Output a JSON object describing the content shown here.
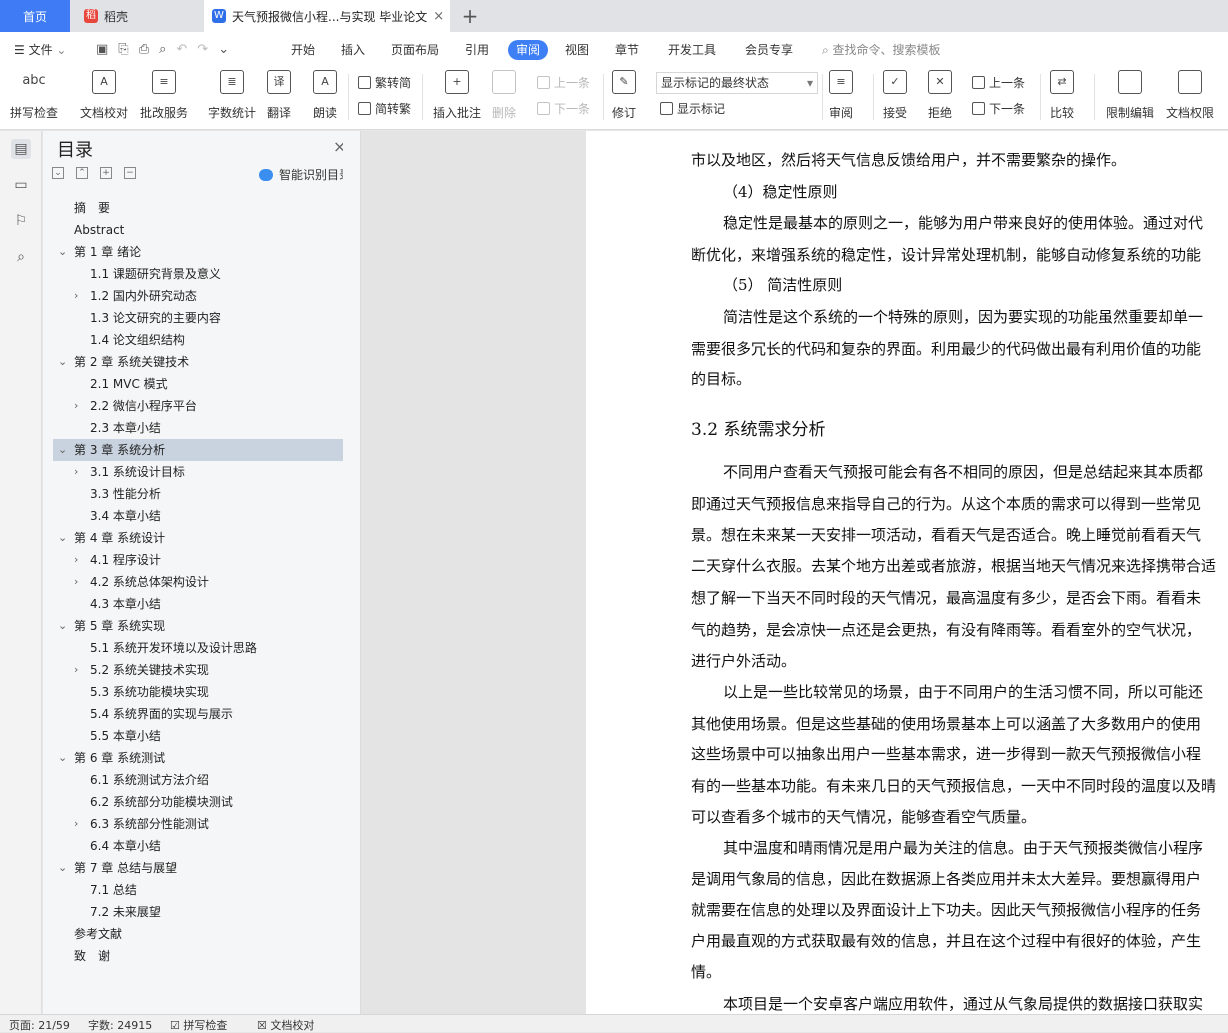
{
  "tabs": {
    "home": "首页",
    "daoke": "稻壳",
    "doc": "天气预报微信小程...与实现 毕业论文",
    "add": "+"
  },
  "menu": {
    "file": "文件",
    "items": [
      "开始",
      "插入",
      "页面布局",
      "引用",
      "审阅",
      "视图",
      "章节",
      "开发工具",
      "会员专享"
    ],
    "search": "查找命令、搜索模板"
  },
  "ribbon": {
    "spell": "拼写检查",
    "doccheck": "文档校对",
    "batch": "批改服务",
    "wordcount": "字数统计",
    "translate": "翻译",
    "read": "朗读",
    "trad": "繁转简",
    "simp": "简转繁",
    "comment": "插入批注",
    "delete": "删除",
    "prev": "上一条",
    "next": "下一条",
    "revise": "修订",
    "markstate": "显示标记的最终状态",
    "showmark": "显示标记",
    "review": "审阅",
    "accept": "接受",
    "reject": "拒绝",
    "prev2": "上一条",
    "next2": "下一条",
    "compare": "比较",
    "restrict": "限制编辑",
    "rights": "文档权限",
    "abc": "abc"
  },
  "nav": {
    "title": "目录",
    "smart": "智能识别目录",
    "items": [
      {
        "t": "摘　要",
        "lvl": 1,
        "arrow": ""
      },
      {
        "t": "Abstract",
        "lvl": 1,
        "arrow": ""
      },
      {
        "t": "第 1 章  绪论",
        "lvl": 1,
        "arrow": "v"
      },
      {
        "t": "1.1 课题研究背景及意义",
        "lvl": 2,
        "arrow": ""
      },
      {
        "t": "1.2 国内外研究动态",
        "lvl": 2,
        "arrow": ">"
      },
      {
        "t": "1.3 论文研究的主要内容",
        "lvl": 2,
        "arrow": ""
      },
      {
        "t": "1.4 论文组织结构",
        "lvl": 2,
        "arrow": ""
      },
      {
        "t": "第 2 章  系统关键技术",
        "lvl": 1,
        "arrow": "v"
      },
      {
        "t": "2.1 MVC 模式",
        "lvl": 2,
        "arrow": ""
      },
      {
        "t": "2.2  微信小程序平台",
        "lvl": 2,
        "arrow": ">"
      },
      {
        "t": "2.3 本章小结",
        "lvl": 2,
        "arrow": ""
      },
      {
        "t": "第 3 章  系统分析",
        "lvl": 1,
        "arrow": "v"
      },
      {
        "t": "3.1 系统设计目标",
        "lvl": 2,
        "arrow": ">"
      },
      {
        "t": "3.3 性能分析",
        "lvl": 2,
        "arrow": ""
      },
      {
        "t": "3.4 本章小结",
        "lvl": 2,
        "arrow": ""
      },
      {
        "t": "第 4 章  系统设计",
        "lvl": 1,
        "arrow": "v"
      },
      {
        "t": "4.1 程序设计",
        "lvl": 2,
        "arrow": ">"
      },
      {
        "t": "4.2 系统总体架构设计",
        "lvl": 2,
        "arrow": ">"
      },
      {
        "t": "4.3 本章小结",
        "lvl": 2,
        "arrow": ""
      },
      {
        "t": "第 5 章  系统实现",
        "lvl": 1,
        "arrow": "v"
      },
      {
        "t": "5.1 系统开发环境以及设计思路",
        "lvl": 2,
        "arrow": ""
      },
      {
        "t": "5.2 系统关键技术实现",
        "lvl": 2,
        "arrow": ">"
      },
      {
        "t": "5.3 系统功能模块实现",
        "lvl": 2,
        "arrow": ""
      },
      {
        "t": "5.4 系统界面的实现与展示",
        "lvl": 2,
        "arrow": ""
      },
      {
        "t": "5.5 本章小结",
        "lvl": 2,
        "arrow": ""
      },
      {
        "t": "第 6 章  系统测试",
        "lvl": 1,
        "arrow": "v"
      },
      {
        "t": "6.1 系统测试方法介绍",
        "lvl": 2,
        "arrow": ""
      },
      {
        "t": "6.2 系统部分功能模块测试",
        "lvl": 2,
        "arrow": ""
      },
      {
        "t": "6.3 系统部分性能测试",
        "lvl": 2,
        "arrow": ">"
      },
      {
        "t": "6.4 本章小结",
        "lvl": 2,
        "arrow": ""
      },
      {
        "t": "第 7 章  总结与展望",
        "lvl": 1,
        "arrow": "v"
      },
      {
        "t": "7.1 总结",
        "lvl": 2,
        "arrow": ""
      },
      {
        "t": "7.2 未来展望",
        "lvl": 2,
        "arrow": ""
      },
      {
        "t": "参考文献",
        "lvl": 1,
        "arrow": ""
      },
      {
        "t": "致　谢",
        "lvl": 1,
        "arrow": ""
      }
    ]
  },
  "doc": {
    "lines": [
      {
        "t": "市以及地区，然后将天气信息反馈给用户，并不需要繁杂的操作。",
        "k": "p"
      },
      {
        "t": "（4）稳定性原则",
        "k": "i"
      },
      {
        "t": "稳定性是最基本的原则之一，能够为用户带来良好的使用体验。通过对代",
        "k": "i"
      },
      {
        "t": "断优化，来增强系统的稳定性，设计异常处理机制，能够自动修复系统的功能",
        "k": "p"
      },
      {
        "t": "（5）  简洁性原则",
        "k": "i"
      },
      {
        "t": "简洁性是这个系统的一个特殊的原则，因为要实现的功能虽然重要却单一",
        "k": "i"
      },
      {
        "t": "需要很多冗长的代码和复杂的界面。利用最少的代码做出最有利用价值的功能",
        "k": "p"
      },
      {
        "t": "的目标。",
        "k": "p"
      },
      {
        "t": "3.2 系统需求分析",
        "k": "h"
      },
      {
        "t": "不同用户查看天气预报可能会有各不相同的原因，但是总结起来其本质都",
        "k": "i"
      },
      {
        "t": "即通过天气预报信息来指导自己的行为。从这个本质的需求可以得到一些常见",
        "k": "p"
      },
      {
        "t": "景。想在未来某一天安排一项活动，看看天气是否适合。晚上睡觉前看看天气",
        "k": "p"
      },
      {
        "t": "二天穿什么衣服。去某个地方出差或者旅游，根据当地天气情况来选择携带合适",
        "k": "p"
      },
      {
        "t": "想了解一下当天不同时段的天气情况，最高温度有多少，是否会下雨。看看未",
        "k": "p"
      },
      {
        "t": "气的趋势，是会凉快一点还是会更热，有没有降雨等。看看室外的空气状况，",
        "k": "p"
      },
      {
        "t": "进行户外活动。",
        "k": "p"
      },
      {
        "t": "以上是一些比较常见的场景，由于不同用户的生活习惯不同，所以可能还",
        "k": "i"
      },
      {
        "t": "其他使用场景。但是这些基础的使用场景基本上可以涵盖了大多数用户的使用",
        "k": "p"
      },
      {
        "t": "这些场景中可以抽象出用户一些基本需求，进一步得到一款天气预报微信小程",
        "k": "p"
      },
      {
        "t": "有的一些基本功能。有未来几日的天气预报信息，一天中不同时段的温度以及晴",
        "k": "p"
      },
      {
        "t": "可以查看多个城市的天气情况，能够查看空气质量。",
        "k": "p"
      },
      {
        "t": "其中温度和晴雨情况是用户最为关注的信息。由于天气预报类微信小程序",
        "k": "i"
      },
      {
        "t": "是调用气象局的信息，因此在数据源上各类应用并未太大差异。要想赢得用户",
        "k": "p"
      },
      {
        "t": "就需要在信息的处理以及界面设计上下功夫。因此天气预报微信小程序的任务",
        "k": "p"
      },
      {
        "t": "户用最直观的方式获取最有效的信息，并且在这个过程中有很好的体验，产生",
        "k": "p"
      },
      {
        "t": "情。",
        "k": "p"
      },
      {
        "t": "本项目是一个安卓客户端应用软件，通过从气象局提供的数据接口获取实",
        "k": "i"
      }
    ]
  },
  "status": {
    "page": "页面: 21/59",
    "words": "字数: 24915",
    "spell": "拼写检查",
    "check": "文档校对"
  }
}
